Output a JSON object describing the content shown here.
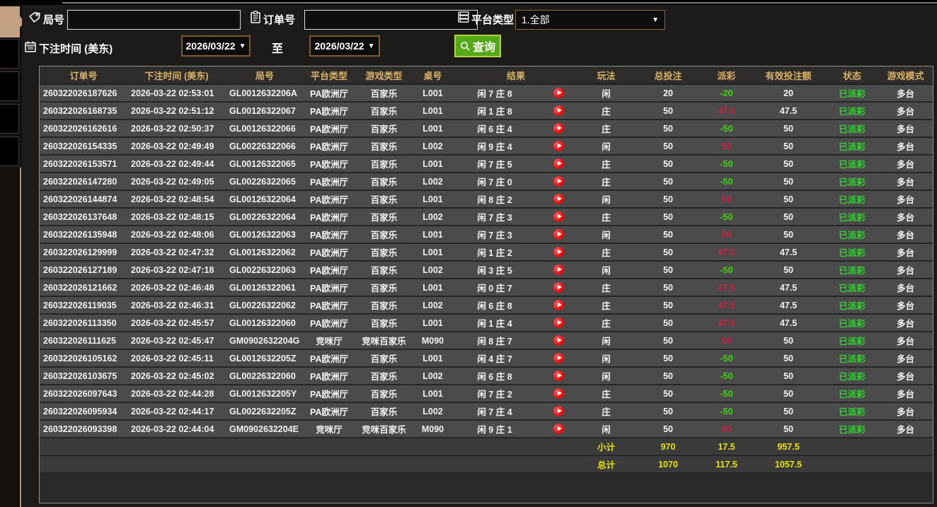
{
  "filters": {
    "round_label": "局号",
    "round_value": "",
    "order_label": "订单号",
    "order_value": "",
    "platform_label": "平台类型",
    "platform_value": "1.全部",
    "bet_time_label": "下注时间 (美东)",
    "date_from": "2026/03/22",
    "date_to": "2026/03/22",
    "to_label": "至",
    "query_label": "查询"
  },
  "colors": {
    "win": "#d21d45",
    "loss": "#41d40a",
    "status_green": "#35cf35",
    "total_yellow": "#e8e300",
    "header_gold": "#d8b269",
    "accent_tan": "#c3a284",
    "button_green": "#55a818"
  },
  "table": {
    "headers": [
      "订单号",
      "下注时间 (美东)",
      "局号",
      "平台类型",
      "游戏类型",
      "桌号",
      "结果",
      "玩法",
      "总投注",
      "派彩",
      "有效投注额",
      "状态",
      "游戏模式"
    ],
    "rows": [
      {
        "order": "260322026187626",
        "time": "2026-03-22 02:53:01",
        "round": "GL0012632206A",
        "platform": "PA欧洲厅",
        "game_type": "百家乐",
        "table_no": "L001",
        "result": "闲 7 庄 8",
        "play_type": "闲",
        "total_bet": "20",
        "payout": "-20",
        "payout_color": "loss",
        "valid_bet": "20",
        "status": "已派彩",
        "mode": "多台"
      },
      {
        "order": "260322026168735",
        "time": "2026-03-22 02:51:12",
        "round": "GL00126322067",
        "platform": "PA欧洲厅",
        "game_type": "百家乐",
        "table_no": "L001",
        "result": "闲 1 庄 8",
        "play_type": "庄",
        "total_bet": "50",
        "payout": "47.5",
        "payout_color": "win",
        "valid_bet": "47.5",
        "status": "已派彩",
        "mode": "多台"
      },
      {
        "order": "260322026162616",
        "time": "2026-03-22 02:50:37",
        "round": "GL00126322066",
        "platform": "PA欧洲厅",
        "game_type": "百家乐",
        "table_no": "L001",
        "result": "闲 6 庄 4",
        "play_type": "庄",
        "total_bet": "50",
        "payout": "-50",
        "payout_color": "loss",
        "valid_bet": "50",
        "status": "已派彩",
        "mode": "多台"
      },
      {
        "order": "260322026154335",
        "time": "2026-03-22 02:49:49",
        "round": "GL00226322066",
        "platform": "PA欧洲厅",
        "game_type": "百家乐",
        "table_no": "L002",
        "result": "闲 9 庄 4",
        "play_type": "闲",
        "total_bet": "50",
        "payout": "50",
        "payout_color": "win",
        "valid_bet": "50",
        "status": "已派彩",
        "mode": "多台"
      },
      {
        "order": "260322026153571",
        "time": "2026-03-22 02:49:44",
        "round": "GL00126322065",
        "platform": "PA欧洲厅",
        "game_type": "百家乐",
        "table_no": "L001",
        "result": "闲 7 庄 5",
        "play_type": "庄",
        "total_bet": "50",
        "payout": "-50",
        "payout_color": "loss",
        "valid_bet": "50",
        "status": "已派彩",
        "mode": "多台"
      },
      {
        "order": "260322026147280",
        "time": "2026-03-22 02:49:05",
        "round": "GL00226322065",
        "platform": "PA欧洲厅",
        "game_type": "百家乐",
        "table_no": "L002",
        "result": "闲 7 庄 0",
        "play_type": "庄",
        "total_bet": "50",
        "payout": "-50",
        "payout_color": "loss",
        "valid_bet": "50",
        "status": "已派彩",
        "mode": "多台"
      },
      {
        "order": "260322026144874",
        "time": "2026-03-22 02:48:54",
        "round": "GL00126322064",
        "platform": "PA欧洲厅",
        "game_type": "百家乐",
        "table_no": "L001",
        "result": "闲 8 庄 2",
        "play_type": "闲",
        "total_bet": "50",
        "payout": "50",
        "payout_color": "win",
        "valid_bet": "50",
        "status": "已派彩",
        "mode": "多台"
      },
      {
        "order": "260322026137648",
        "time": "2026-03-22 02:48:15",
        "round": "GL00226322064",
        "platform": "PA欧洲厅",
        "game_type": "百家乐",
        "table_no": "L002",
        "result": "闲 7 庄 3",
        "play_type": "庄",
        "total_bet": "50",
        "payout": "-50",
        "payout_color": "loss",
        "valid_bet": "50",
        "status": "已派彩",
        "mode": "多台"
      },
      {
        "order": "260322026135948",
        "time": "2026-03-22 02:48:06",
        "round": "GL00126322063",
        "platform": "PA欧洲厅",
        "game_type": "百家乐",
        "table_no": "L001",
        "result": "闲 7 庄 3",
        "play_type": "闲",
        "total_bet": "50",
        "payout": "50",
        "payout_color": "win",
        "valid_bet": "50",
        "status": "已派彩",
        "mode": "多台"
      },
      {
        "order": "260322026129999",
        "time": "2026-03-22 02:47:32",
        "round": "GL00126322062",
        "platform": "PA欧洲厅",
        "game_type": "百家乐",
        "table_no": "L001",
        "result": "闲 1 庄 2",
        "play_type": "庄",
        "total_bet": "50",
        "payout": "47.5",
        "payout_color": "win",
        "valid_bet": "47.5",
        "status": "已派彩",
        "mode": "多台"
      },
      {
        "order": "260322026127189",
        "time": "2026-03-22 02:47:18",
        "round": "GL00226322063",
        "platform": "PA欧洲厅",
        "game_type": "百家乐",
        "table_no": "L002",
        "result": "闲 3 庄 5",
        "play_type": "闲",
        "total_bet": "50",
        "payout": "-50",
        "payout_color": "loss",
        "valid_bet": "50",
        "status": "已派彩",
        "mode": "多台"
      },
      {
        "order": "260322026121662",
        "time": "2026-03-22 02:46:48",
        "round": "GL00126322061",
        "platform": "PA欧洲厅",
        "game_type": "百家乐",
        "table_no": "L001",
        "result": "闲 0 庄 7",
        "play_type": "庄",
        "total_bet": "50",
        "payout": "47.5",
        "payout_color": "win",
        "valid_bet": "47.5",
        "status": "已派彩",
        "mode": "多台"
      },
      {
        "order": "260322026119035",
        "time": "2026-03-22 02:46:31",
        "round": "GL00226322062",
        "platform": "PA欧洲厅",
        "game_type": "百家乐",
        "table_no": "L002",
        "result": "闲 6 庄 8",
        "play_type": "庄",
        "total_bet": "50",
        "payout": "47.5",
        "payout_color": "win",
        "valid_bet": "47.5",
        "status": "已派彩",
        "mode": "多台"
      },
      {
        "order": "260322026113350",
        "time": "2026-03-22 02:45:57",
        "round": "GL00126322060",
        "platform": "PA欧洲厅",
        "game_type": "百家乐",
        "table_no": "L001",
        "result": "闲 1 庄 4",
        "play_type": "庄",
        "total_bet": "50",
        "payout": "47.5",
        "payout_color": "win",
        "valid_bet": "47.5",
        "status": "已派彩",
        "mode": "多台"
      },
      {
        "order": "260322026111625",
        "time": "2026-03-22 02:45:47",
        "round": "GM0902632204G",
        "platform": "竞咪厅",
        "game_type": "竞咪百家乐",
        "table_no": "M090",
        "result": "闲 8 庄 7",
        "play_type": "闲",
        "total_bet": "50",
        "payout": "50",
        "payout_color": "win",
        "valid_bet": "50",
        "status": "已派彩",
        "mode": "多台"
      },
      {
        "order": "260322026105162",
        "time": "2026-03-22 02:45:11",
        "round": "GL0012632205Z",
        "platform": "PA欧洲厅",
        "game_type": "百家乐",
        "table_no": "L001",
        "result": "闲 4 庄 7",
        "play_type": "闲",
        "total_bet": "50",
        "payout": "-50",
        "payout_color": "loss",
        "valid_bet": "50",
        "status": "已派彩",
        "mode": "多台"
      },
      {
        "order": "260322026103675",
        "time": "2026-03-22 02:45:02",
        "round": "GL00226322060",
        "platform": "PA欧洲厅",
        "game_type": "百家乐",
        "table_no": "L002",
        "result": "闲 6 庄 8",
        "play_type": "闲",
        "total_bet": "50",
        "payout": "-50",
        "payout_color": "loss",
        "valid_bet": "50",
        "status": "已派彩",
        "mode": "多台"
      },
      {
        "order": "260322026097643",
        "time": "2026-03-22 02:44:28",
        "round": "GL0012632205Y",
        "platform": "PA欧洲厅",
        "game_type": "百家乐",
        "table_no": "L001",
        "result": "闲 7 庄 2",
        "play_type": "庄",
        "total_bet": "50",
        "payout": "-50",
        "payout_color": "loss",
        "valid_bet": "50",
        "status": "已派彩",
        "mode": "多台"
      },
      {
        "order": "260322026095934",
        "time": "2026-03-22 02:44:17",
        "round": "GL0022632205Z",
        "platform": "PA欧洲厅",
        "game_type": "百家乐",
        "table_no": "L002",
        "result": "闲 7 庄 4",
        "play_type": "庄",
        "total_bet": "50",
        "payout": "-50",
        "payout_color": "loss",
        "valid_bet": "50",
        "status": "已派彩",
        "mode": "多台"
      },
      {
        "order": "260322026093398",
        "time": "2026-03-22 02:44:04",
        "round": "GM0902632204E",
        "platform": "竞咪厅",
        "game_type": "竞咪百家乐",
        "table_no": "M090",
        "result": "闲 9 庄 1",
        "play_type": "闲",
        "total_bet": "50",
        "payout": "50",
        "payout_color": "win",
        "valid_bet": "50",
        "status": "已派彩",
        "mode": "多台"
      }
    ],
    "subtotal": {
      "label": "小计",
      "total_bet": "970",
      "payout": "17.5",
      "valid_bet": "957.5"
    },
    "total": {
      "label": "总计",
      "total_bet": "1070",
      "payout": "117.5",
      "valid_bet": "1057.5"
    }
  }
}
